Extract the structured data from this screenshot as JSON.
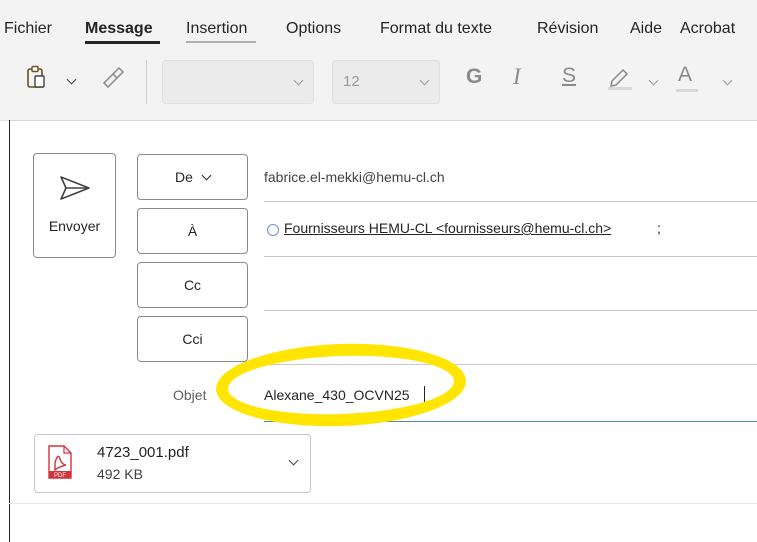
{
  "menu": {
    "items": [
      "Fichier",
      "Message",
      "Insertion",
      "Options",
      "Format du texte",
      "Révision",
      "Aide",
      "Acrobat"
    ],
    "active": "Message"
  },
  "ribbon": {
    "font_name_value": "",
    "font_size_value": "12",
    "bold_glyph": "G",
    "italic_glyph": "I",
    "underline_glyph": "S",
    "highlight_icon": "highlighter-icon",
    "font_color_glyph": "A",
    "paste_icon": "paste-icon",
    "format_painter_icon": "format-painter-icon"
  },
  "compose": {
    "send_label": "Envoyer",
    "from_button": "De",
    "from_value": "fabrice.el-mekki@hemu-cl.ch",
    "to_button": "À",
    "to_recipient": "Fournisseurs HEMU-CL <fournisseurs@hemu-cl.ch>",
    "to_separator": ";",
    "cc_button": "Cc",
    "bcc_button": "Cci",
    "subject_label": "Objet",
    "subject_value": "Alexane_430_OCVN25"
  },
  "attachment": {
    "name": "4723_001.pdf",
    "size": "492 KB",
    "type_label": "PDF"
  },
  "colors": {
    "highlight_annotation": "#ffe500",
    "pdf_red": "#d13438",
    "focus_line": "#4a8f9c"
  }
}
